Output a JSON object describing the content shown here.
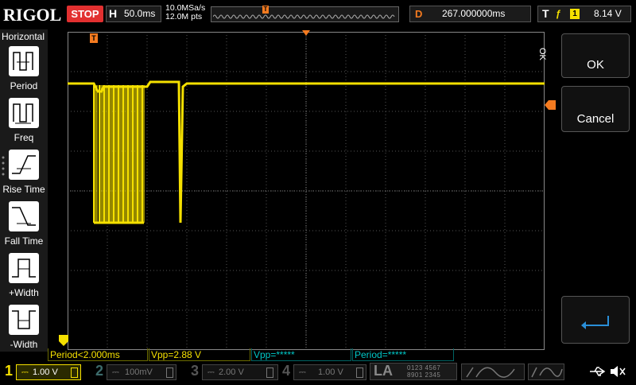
{
  "top": {
    "logo": "RIGOL",
    "status": "STOP",
    "horizontal_key": "H",
    "timebase": "50.0ms",
    "sample_rate": "10.0MSa/s",
    "memory_depth": "12.0M pts",
    "trigger_mark": "T",
    "delay_key": "D",
    "delay_value": "267.000000ms",
    "trigger_key": "T",
    "trigger_edge": "ƒ",
    "trigger_source": "1",
    "trigger_level": "8.14 V"
  },
  "left_menu": {
    "title": "Horizontal",
    "items": [
      {
        "label": "Period",
        "icon": "period-icon"
      },
      {
        "label": "Freq",
        "icon": "freq-icon"
      },
      {
        "label": "Rise Time",
        "icon": "rise-time-icon"
      },
      {
        "label": "Fall Time",
        "icon": "fall-time-icon"
      },
      {
        "label": "+Width",
        "icon": "positive-width-icon"
      },
      {
        "label": "-Width",
        "icon": "negative-width-icon"
      }
    ]
  },
  "right_menu": {
    "ok_side": "OK",
    "ok_label": "OK",
    "cancel_label": "Cancel",
    "return_icon": "return-arrow-icon"
  },
  "measurements": [
    {
      "text": "Period<2.000ms",
      "color": "#f5e000"
    },
    {
      "text": "Vpp=2.88 V",
      "color": "#f5e000"
    },
    {
      "text": "Vpp=*****",
      "color": "#00c8c8"
    },
    {
      "text": "Period=*****",
      "color": "#00c8c8"
    }
  ],
  "channels": [
    {
      "num": "1",
      "scale": "1.00 V",
      "color": "#f5e000",
      "active": true
    },
    {
      "num": "2",
      "scale": "100mV",
      "color": "#3c6b6b",
      "active": false
    },
    {
      "num": "3",
      "scale": "2.00 V",
      "color": "#555555",
      "active": false
    },
    {
      "num": "4",
      "scale": "1.00 V",
      "color": "#555555",
      "active": false
    }
  ],
  "la": {
    "label": "LA",
    "row1": "0123 4567",
    "row2": "8901 2345"
  },
  "grid_marker": "T",
  "waveform": {
    "color": "#f5e000",
    "level_high_div": 1.3,
    "level_low_div": 4.8
  }
}
